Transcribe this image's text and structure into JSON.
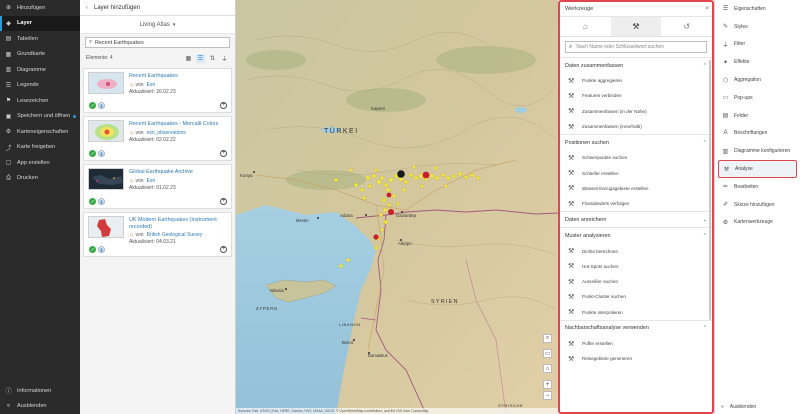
{
  "leftnav": {
    "items": [
      {
        "label": "Hinzufügen",
        "icon": "plus-icon"
      },
      {
        "label": "Layer",
        "icon": "layers-icon",
        "active": true
      },
      {
        "label": "Tabellen",
        "icon": "table-icon"
      },
      {
        "label": "Grundkarte",
        "icon": "basemap-icon"
      },
      {
        "label": "Diagramme",
        "icon": "chart-icon"
      },
      {
        "label": "Legende",
        "icon": "legend-icon"
      },
      {
        "label": "Lesezeichen",
        "icon": "bookmark-icon"
      },
      {
        "label": "Speichern und öffnen",
        "icon": "save-icon",
        "dot": true
      },
      {
        "label": "Karteneigenschaften",
        "icon": "gear-icon"
      },
      {
        "label": "Karte freigeben",
        "icon": "share-icon"
      },
      {
        "label": "App erstellen",
        "icon": "app-icon"
      },
      {
        "label": "Drucken",
        "icon": "print-icon"
      }
    ],
    "bottom": [
      {
        "label": "Informationen",
        "icon": "info-icon"
      },
      {
        "label": "Ausblenden",
        "icon": "collapse-icon"
      }
    ]
  },
  "layerpanel": {
    "title": "Layer hinzufügen",
    "source": "Living Atlas",
    "search_value": "Recent Earthquakes",
    "count_label": "Elemente: 4",
    "cards": [
      {
        "title": "Recent Earthquakes",
        "owner_prefix": "von",
        "owner": "Esri",
        "updated": "Aktualisiert: 26.02.23",
        "thumb": "map-thumb-pink"
      },
      {
        "title": "Recent Earthquakes - Mercalli Colors",
        "owner_prefix": "von",
        "owner": "esri_observations",
        "updated": "Aktualisiert: 02.02.22",
        "thumb": "map-thumb-mercalli"
      },
      {
        "title": "Global Earthquake Archive",
        "owner_prefix": "von",
        "owner": "Esri",
        "updated": "Aktualisiert: 01.02.23",
        "thumb": "map-thumb-dark"
      },
      {
        "title": "UK Modern Earthquakes (Instrument recorded)",
        "owner_prefix": "von",
        "owner": "British Geological Survey",
        "updated": "Aktualisiert: 04.03.21",
        "thumb": "map-thumb-uk"
      }
    ]
  },
  "map": {
    "labels": {
      "turkei": "TÜRKEI",
      "syrien": "SYRIEN",
      "zypern": "ZYPERN",
      "libanon": "LIBANON",
      "konya": "Konya",
      "adana": "Adana",
      "gaziantep": "Gaziantep",
      "aleppo": "Aleppo",
      "nicosia": "Nikosia",
      "beirut": "Beirut",
      "damascus": "Damaskus",
      "mersin": "Mersin",
      "ankara": "Kayseri",
      "syrische": "SYRISCHE"
    },
    "attribution": "Sources: Esri, USGS | Esri, HERE, Garmin, FAO, NOAA, USGS, © OpenStreetMap contributors, and the GIS User Community",
    "powered": "Powered by Esri"
  },
  "tools": {
    "title": "Werkzeuge",
    "search_placeholder": "Nach Name oder Schlüsselwort suchen",
    "tabs": [
      {
        "icon": "home-icon",
        "glyph": "⌂"
      },
      {
        "icon": "hammer-icon",
        "glyph": "⚒",
        "active": true
      },
      {
        "icon": "history-icon",
        "glyph": "↺"
      }
    ],
    "groups": [
      {
        "label": "Daten zusammenfassen",
        "expanded": true,
        "items": [
          "Punkte aggregieren",
          "Features verbinden",
          "Zusammenfassen (in der Nähe)",
          "Zusammenfassen (innerhalb)"
        ]
      },
      {
        "label": "Positionen suchen",
        "expanded": true,
        "items": [
          "Schwerpunkte suchen",
          "Schleifer erstellen",
          "Wasserrinnzugsgebiete erstellen",
          "Flussabwärts verfolgen"
        ]
      },
      {
        "label": "Daten anreichern",
        "expanded": false,
        "items": []
      },
      {
        "label": "Muster analysieren",
        "expanded": true,
        "items": [
          "Dichte berechnen",
          "Hot-Spots suchen",
          "Ausreißer suchen",
          "Punkt-Cluster suchen",
          "Punkte interpolieren"
        ]
      },
      {
        "label": "Nachbarschaftsanalyse verwenden",
        "expanded": true,
        "items": [
          "Puffer erstellen",
          "Reisegebiete generieren"
        ]
      }
    ]
  },
  "rightbar": {
    "items": [
      {
        "label": "Eigenschaften",
        "icon": "properties-icon",
        "glyph": "☰"
      },
      {
        "label": "Styles",
        "icon": "styles-icon",
        "glyph": "✎"
      },
      {
        "label": "Filter",
        "icon": "filter-icon",
        "glyph": "⏚"
      },
      {
        "label": "Effekte",
        "icon": "effects-icon",
        "glyph": "✦"
      },
      {
        "label": "Aggregation",
        "icon": "aggregation-icon",
        "glyph": "⬡"
      },
      {
        "label": "Pop-ups",
        "icon": "popup-icon",
        "glyph": "▭"
      },
      {
        "label": "Felder",
        "icon": "fields-icon",
        "glyph": "▤"
      },
      {
        "label": "Beschriftungen",
        "icon": "labels-icon",
        "glyph": "A"
      },
      {
        "label": "Diagramme konfigurieren",
        "icon": "chart-config-icon",
        "glyph": "▥"
      },
      {
        "label": "Analyse",
        "icon": "analysis-icon",
        "glyph": "⚒",
        "highlight": true
      },
      {
        "label": "Bearbeiten",
        "icon": "edit-icon",
        "glyph": "✏"
      },
      {
        "label": "Skizze hinzufügen",
        "icon": "sketch-icon",
        "glyph": "✐"
      },
      {
        "label": "Kartenwerkzeuge",
        "icon": "map-tools-icon",
        "glyph": "⚙"
      }
    ],
    "bottom": "Ausblenden"
  },
  "colors": {
    "accent": "#2d9bd6",
    "highlight": "#e0464f",
    "nav_bg": "#2b2b2b"
  }
}
